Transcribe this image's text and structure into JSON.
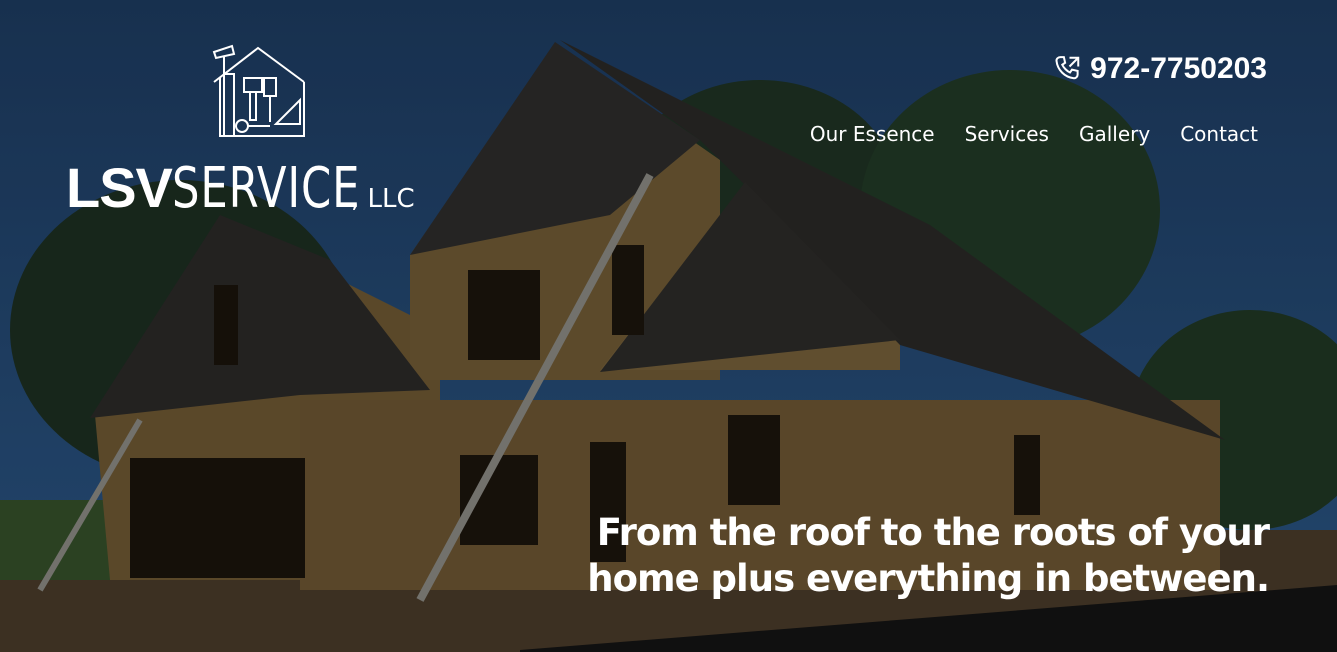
{
  "brand": {
    "name_bold": "LSV",
    "name_light": "SERVICE",
    "suffix": ", LLC"
  },
  "header": {
    "phone": "972-7750203",
    "nav": [
      {
        "label": "Our Essence"
      },
      {
        "label": "Services"
      },
      {
        "label": "Gallery"
      },
      {
        "label": "Contact"
      }
    ]
  },
  "hero": {
    "tagline_line1": "From the roof to the roots of your",
    "tagline_line2": "home plus everything in between."
  },
  "colors": {
    "sky": "#1e3f66",
    "text": "#ffffff"
  },
  "icons": [
    "house-tools-logo-icon",
    "phone-icon"
  ]
}
